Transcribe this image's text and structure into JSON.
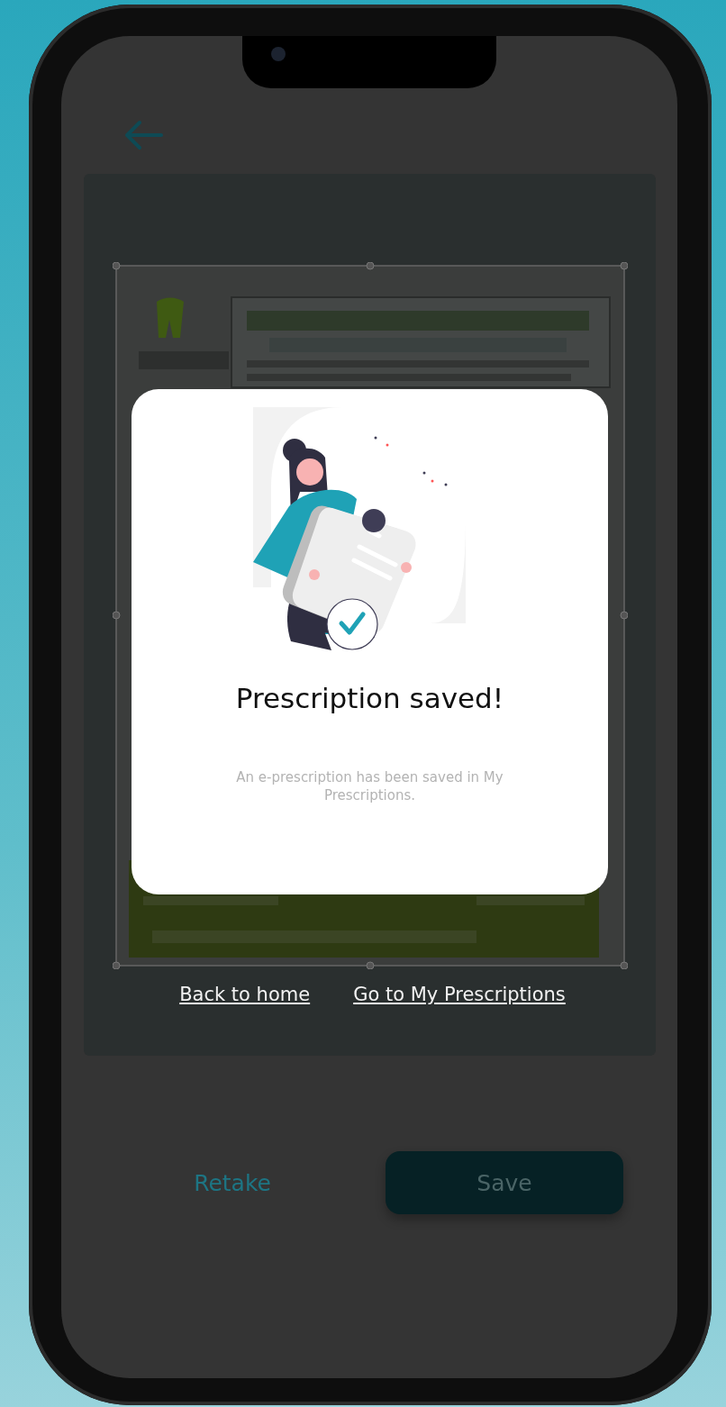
{
  "dialog": {
    "title": "Prescription saved!",
    "message": "An e-prescription has been saved in My Prescriptions."
  },
  "links": [
    "Back to home",
    "Go to My Prescriptions"
  ],
  "actions": [
    {
      "label": "Retake",
      "kind": "text"
    },
    {
      "label": "Save",
      "kind": "filled"
    }
  ]
}
